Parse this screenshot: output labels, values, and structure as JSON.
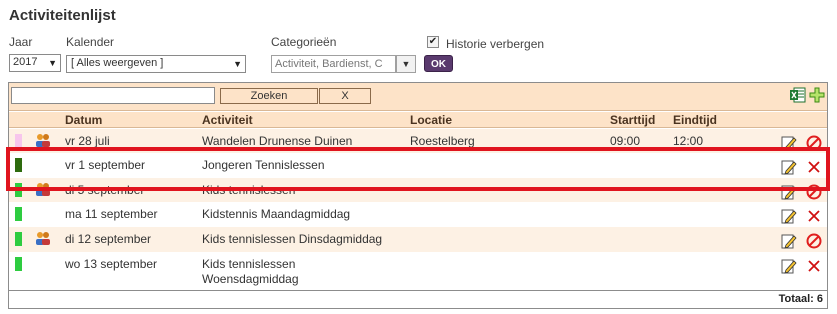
{
  "page": {
    "title": "Activiteitenlijst"
  },
  "filters": {
    "year_label": "Jaar",
    "year_value": "2017",
    "calendar_label": "Kalender",
    "calendar_value": "[ Alles weergeven ]",
    "categories_label": "Categorieën",
    "categories_value": "Activiteit, Bardienst, C",
    "ok_label": "OK",
    "history_label": "Historie verbergen",
    "history_checked": true
  },
  "search": {
    "value": "",
    "search_label": "Zoeken",
    "clear_label": "X"
  },
  "icons": {
    "export": "excel-export-icon",
    "add": "add-plus-icon",
    "people": "people-icon",
    "edit": "edit-pencil-icon",
    "forbidden": "forbidden-icon",
    "delete": "delete-x-icon"
  },
  "columns": {
    "date": "Datum",
    "activity": "Activiteit",
    "location": "Locatie",
    "start": "Starttijd",
    "end": "Eindtijd"
  },
  "rows": [
    {
      "color": "#f7c6ec",
      "people": true,
      "date": "vr 28 juli",
      "activity": "Wandelen Drunense Duinen",
      "location": "Roestelberg",
      "start": "09:00",
      "end": "12:00",
      "action": "forbidden"
    },
    {
      "color": "#2e6b0e",
      "people": false,
      "date": "vr 1 september",
      "activity": "Jongeren Tennislessen",
      "location": "",
      "start": "",
      "end": "",
      "action": "delete"
    },
    {
      "color": "#2ecc40",
      "people": true,
      "date": "di 5 september",
      "activity": "Kids tennislessen",
      "location": "",
      "start": "",
      "end": "",
      "action": "forbidden"
    },
    {
      "color": "#2ecc40",
      "people": false,
      "date": "ma 11 september",
      "activity": "Kidstennis Maandagmiddag",
      "location": "",
      "start": "",
      "end": "",
      "action": "delete"
    },
    {
      "color": "#2ecc40",
      "people": true,
      "date": "di 12 september",
      "activity": "Kids tennislessen Dinsdagmiddag",
      "location": "",
      "start": "",
      "end": "",
      "action": "forbidden"
    },
    {
      "color": "#2ecc40",
      "people": false,
      "date": "wo 13 september",
      "activity": "Kids tennislessen\nWoensdagmiddag",
      "location": "",
      "start": "",
      "end": "",
      "action": "delete"
    }
  ],
  "footer": {
    "total": "Totaal: 6"
  },
  "colors": {
    "header_bg": "#fde3c8",
    "alt_row_bg": "#fdf1e4",
    "highlight": "#e0141e"
  }
}
